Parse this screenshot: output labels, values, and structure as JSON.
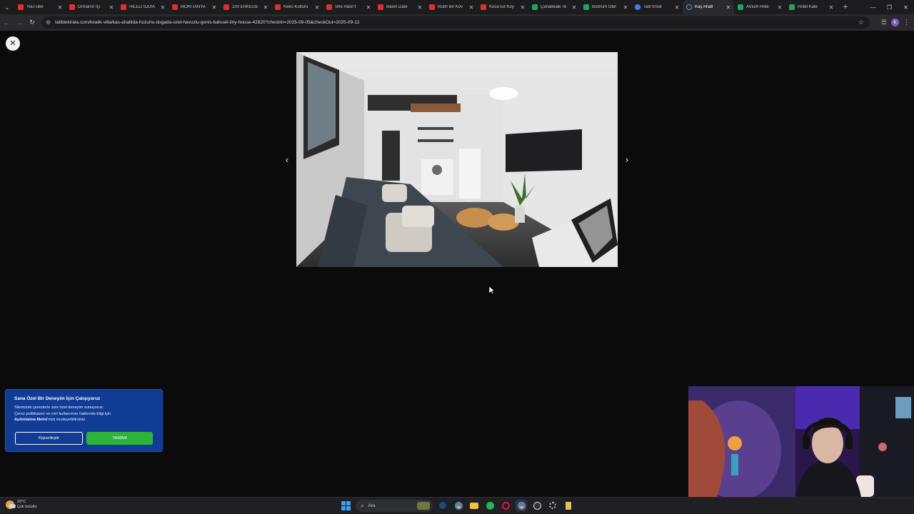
{
  "browser": {
    "tabs": [
      {
        "label": "YouTube",
        "icon": "youtube-icon",
        "kind": "yt"
      },
      {
        "label": "Ormanın İçi",
        "icon": "youtube-icon",
        "kind": "yt"
      },
      {
        "label": "HİLELİ İDDİA",
        "icon": "youtube-icon",
        "kind": "yt"
      },
      {
        "label": "MORITANYA",
        "icon": "youtube-icon",
        "kind": "yt"
      },
      {
        "label": "100 ERKEĞE",
        "icon": "youtube-icon",
        "kind": "yt"
      },
      {
        "label": "Keko Kültürü",
        "icon": "youtube-icon",
        "kind": "yt"
      },
      {
        "label": "She Hasn't",
        "icon": "youtube-icon",
        "kind": "yt"
      },
      {
        "label": "Balon Date",
        "icon": "youtube-icon",
        "kind": "yt"
      },
      {
        "label": "Rutin Bir Kov",
        "icon": "youtube-icon",
        "kind": "yt"
      },
      {
        "label": "Koca Ed Köy",
        "icon": "youtube-icon",
        "kind": "yt"
      },
      {
        "label": "Çanakkale Te",
        "icon": "sheet-icon",
        "kind": "sheet"
      },
      {
        "label": "Bodrum Otel",
        "icon": "sheet-icon",
        "kind": "sheet"
      },
      {
        "label": "Tatil fırsat",
        "icon": "google-icon",
        "kind": "gl"
      },
      {
        "label": "Kaş Ahatl",
        "icon": "loading-icon",
        "kind": "ld",
        "active": true
      },
      {
        "label": "Atrium Hote",
        "icon": "sheet-icon",
        "kind": "sheet"
      },
      {
        "label": "Hotel Kale",
        "icon": "sheet-icon",
        "kind": "sheet"
      }
    ],
    "url": "tatildekirala.com/kiralik-villa/kas-ahatlida-huzurlu-dogada-ozel-havuzlu-genis-bahceli-tiny-house-42820?checkIn=2025-09-05&checkOut=2025-09-12",
    "profile_initial": "K"
  },
  "viewer": {
    "image_alt": "Tiny house interior with grey sofa, kitchen and TV"
  },
  "cookie_banner": {
    "title": "Sana Özel Bir Deneyim İçin Çalışıyoruz",
    "line1": "Sitemizde çerezlerle size özel deneyim sunuyoruz.",
    "line2": "Çerez politikasını ve veri kullanımını hakkında bilgi için",
    "link": "Aydınlatma Metni",
    "line3_rest": "'mizi inceleyebilirsiniz.",
    "customize_label": "Kişiselleştir",
    "ok_label": "TAMAM"
  },
  "taskbar": {
    "temperature": "22°C",
    "weather": "Çok bulutlu",
    "search_placeholder": "Ara"
  },
  "colors": {
    "cookie_bg": "#103c96",
    "ok_button": "#2fb43b",
    "page_bg": "#0b0b0c"
  }
}
